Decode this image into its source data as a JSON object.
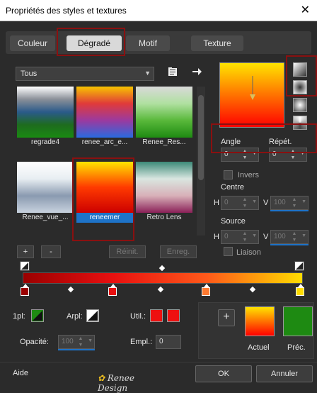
{
  "window": {
    "title": "Propriétés des styles et textures",
    "close": "✕"
  },
  "tabs": [
    {
      "label": "Couleur"
    },
    {
      "label": "Dégradé"
    },
    {
      "label": "Motif"
    },
    {
      "label": "Texture"
    }
  ],
  "library": {
    "filter": "Tous",
    "items": [
      {
        "label": "regrade4",
        "colors": [
          "#ffffff",
          "#8a8f98",
          "#2a5a8a",
          "#1e6b1e",
          "#1a8a12"
        ]
      },
      {
        "label": "renee_arc_e...",
        "colors": [
          "#f7c300",
          "#e03a3a",
          "#9a3aa0",
          "#2a6ae0"
        ]
      },
      {
        "label": "Renee_Res...",
        "colors": [
          "#d9d9d9",
          "#b0e0a0",
          "#58b83a",
          "#1e8a12"
        ]
      },
      {
        "label": "Renee_vue_...",
        "colors": [
          "#ffffff",
          "#e8eef2",
          "#8a9ab0",
          "#c8d2de"
        ]
      },
      {
        "label": "reneemer",
        "colors": [
          "#ffe400",
          "#ff3a00",
          "#cc0000"
        ]
      },
      {
        "label": "Retro Lens",
        "colors": [
          "#3c8a78",
          "#d9e6e0",
          "#d8b0b8",
          "#8a2058"
        ]
      }
    ],
    "selected_index": 4
  },
  "buttons": {
    "add": "+",
    "remove": "-",
    "reinit": "Réinit.",
    "save": "Enreg.",
    "ok": "OK",
    "cancel": "Annuler",
    "help": "Aide",
    "add_swatch": "+"
  },
  "gradient_settings": {
    "angle_label": "Angle",
    "angle": "0",
    "repeat_label": "Répét.",
    "repeat": "0",
    "invert_label": "Invers",
    "center_label": "Centre",
    "center_h": "0",
    "center_v": "100",
    "source_label": "Source",
    "source_h": "0",
    "source_v": "100",
    "h": "H",
    "v": "V",
    "link_label": "Liaison"
  },
  "stops": {
    "colors": [
      "#9a0000",
      "#e81010",
      "#ff7a30",
      "#ffdc00"
    ],
    "positions": [
      0,
      32,
      66,
      100
    ]
  },
  "bottom": {
    "fpl_label": "1pl:",
    "arpl_label": "Arpl:",
    "util_label": "Util.:",
    "opacity_label": "Opacité:",
    "opacity": "100",
    "empl_label": "Empl.:",
    "empl": "0",
    "current_label": "Actuel",
    "prev_label": "Préc.",
    "current_color": "#ff2000",
    "prev_color": "#1e8a12"
  },
  "logo_text": "Renee Design"
}
